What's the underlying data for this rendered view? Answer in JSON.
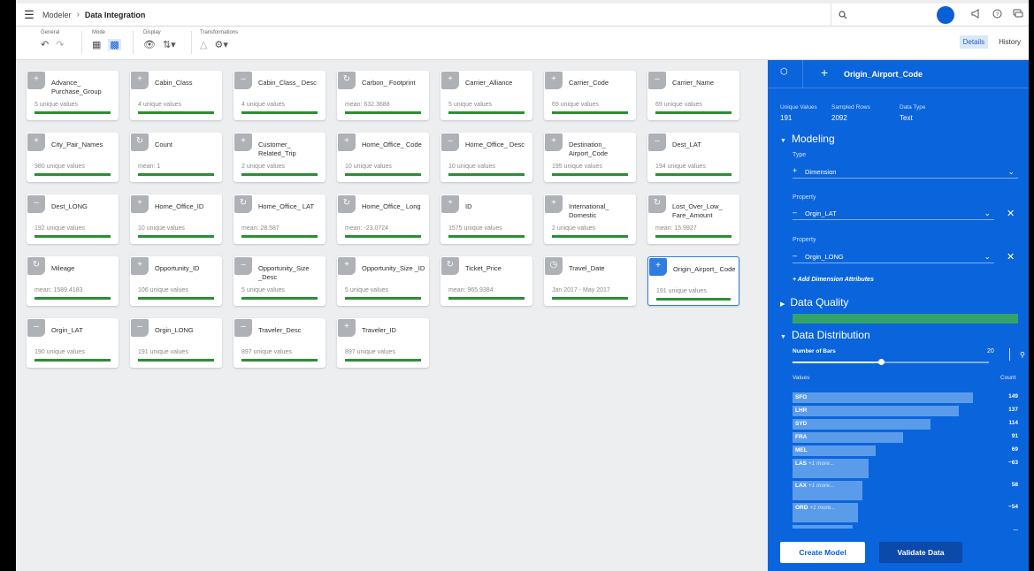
{
  "topbar": {
    "menu_icon": "hamburger-icon",
    "breadcrumb": {
      "root": "Modeler",
      "current": "Data Integration"
    },
    "icons": [
      "search-icon",
      "megaphone-icon",
      "help-icon",
      "feedback-icon"
    ]
  },
  "toolbar": {
    "groups": [
      {
        "label": "General",
        "icons": [
          "undo-icon",
          "redo-icon"
        ]
      },
      {
        "label": "Mode",
        "icons": [
          "table-icon",
          "grid-icon"
        ]
      },
      {
        "label": "Display",
        "icons": [
          "eye-icon",
          "sort-icon"
        ]
      },
      {
        "label": "Transformations",
        "icons": [
          "transform-icon",
          "settings-icon"
        ]
      }
    ],
    "tabs": {
      "details": "Details",
      "history": "History"
    }
  },
  "cards": [
    {
      "type": "dimension",
      "name": "Advance_ Purchase_Group",
      "stat": "5 unique values"
    },
    {
      "type": "dimension",
      "name": "Cabin_Class",
      "stat": "4 unique values"
    },
    {
      "type": "attribute",
      "name": "Cabin_Class_ Desc",
      "stat": "4 unique values"
    },
    {
      "type": "measure",
      "name": "Carbon_ Footprint",
      "stat": "mean: 632.3688"
    },
    {
      "type": "dimension",
      "name": "Carrier_Alliance",
      "stat": "5 unique values"
    },
    {
      "type": "dimension",
      "name": "Carrier_Code",
      "stat": "69 unique values"
    },
    {
      "type": "attribute",
      "name": "Carrier_Name",
      "stat": "69 unique values"
    },
    {
      "type": "dimension",
      "name": "City_Pair_Names",
      "stat": "980 unique values"
    },
    {
      "type": "measure",
      "name": "Count",
      "stat": "mean: 1"
    },
    {
      "type": "dimension",
      "name": "Customer_ Related_Trip",
      "stat": "2 unique values"
    },
    {
      "type": "dimension",
      "name": "Home_Office_ Code",
      "stat": "10 unique values"
    },
    {
      "type": "attribute",
      "name": "Home_Office_ Desc",
      "stat": "10 unique values"
    },
    {
      "type": "dimension",
      "name": "Destination_ Airport_Code",
      "stat": "195 unique values"
    },
    {
      "type": "attribute",
      "name": "Dest_LAT",
      "stat": "194 unique values"
    },
    {
      "type": "attribute",
      "name": "Dest_LONG",
      "stat": "192 unique values"
    },
    {
      "type": "dimension",
      "name": "Home_Office_ID",
      "stat": "10 unique values"
    },
    {
      "type": "measure",
      "name": "Home_Office_ LAT",
      "stat": "mean: 28.587"
    },
    {
      "type": "measure",
      "name": "Home_Office_ Long",
      "stat": "mean: -23.0724"
    },
    {
      "type": "dimension",
      "name": "ID",
      "stat": "1575 unique values"
    },
    {
      "type": "dimension",
      "name": "International_ Domestic",
      "stat": "2 unique values"
    },
    {
      "type": "measure",
      "name": "Lost_Over_Low_ Fare_Amount",
      "stat": "mean: 15.9927"
    },
    {
      "type": "measure",
      "name": "Mileage",
      "stat": "mean: 1589.4183"
    },
    {
      "type": "dimension",
      "name": "Opportunity_ID",
      "stat": "106 unique values"
    },
    {
      "type": "attribute",
      "name": "Opportunity_Size _Desc",
      "stat": "5 unique values"
    },
    {
      "type": "dimension",
      "name": "Opportunity_Size _ID",
      "stat": "5 unique values"
    },
    {
      "type": "measure",
      "name": "Ticket_Price",
      "stat": "mean: 965.9384"
    },
    {
      "type": "date",
      "name": "Travel_Date",
      "stat": "Jan 2017 - May 2017"
    },
    {
      "type": "dimension",
      "name": "Origin_Airport_ Code",
      "stat": "191 unique values",
      "selected": true
    },
    {
      "type": "attribute",
      "name": "Orgin_LAT",
      "stat": "190 unique values"
    },
    {
      "type": "attribute",
      "name": "Orgin_LONG",
      "stat": "191 unique values"
    },
    {
      "type": "attribute",
      "name": "Traveler_Desc",
      "stat": "897 unique values"
    },
    {
      "type": "dimension",
      "name": "Traveler_ID",
      "stat": "897 unique values"
    }
  ],
  "panel": {
    "title": "Origin_Airport_Code",
    "meta": [
      {
        "label": "Unique Values",
        "value": "191"
      },
      {
        "label": "Sampled Rows",
        "value": "2092"
      },
      {
        "label": "Data Type",
        "value": "Text"
      }
    ],
    "modeling": {
      "heading": "Modeling",
      "type_label": "Type",
      "type_value": "Dimension",
      "property_label": "Property",
      "properties": [
        "Orgin_LAT",
        "Orgin_LONG"
      ],
      "add_attr": "+ Add Dimension Attributes"
    },
    "quality": {
      "heading": "Data Quality",
      "score": 1.0
    },
    "distribution": {
      "heading": "Data Distribution",
      "bars_label": "Number of Bars",
      "bars_value": "20",
      "slider_fraction": 0.45,
      "col_values": "Values",
      "col_count": "Count",
      "rows": [
        {
          "value": "SFO",
          "more": "",
          "count": "149",
          "n": 149
        },
        {
          "value": "LHR",
          "more": "",
          "count": "137",
          "n": 137
        },
        {
          "value": "SYD",
          "more": "",
          "count": "114",
          "n": 114
        },
        {
          "value": "FRA",
          "more": "",
          "count": "91",
          "n": 91
        },
        {
          "value": "MEL",
          "more": "",
          "count": "69",
          "n": 69
        },
        {
          "value": "LAS",
          "more": "+1 more...",
          "count": "~63",
          "n": 63
        },
        {
          "value": "LAX",
          "more": "+1 more...",
          "count": "58",
          "n": 58
        },
        {
          "value": "ORD",
          "more": "+1 more...",
          "count": "~54",
          "n": 54
        },
        {
          "value": "",
          "more": "",
          "count": "...",
          "n": 50
        }
      ]
    },
    "buttons": {
      "create": "Create Model",
      "validate": "Validate Data"
    }
  },
  "colors": {
    "accent": "#0a64dc",
    "bar_ok": "#2c8e34",
    "quality": "#34a36a"
  }
}
